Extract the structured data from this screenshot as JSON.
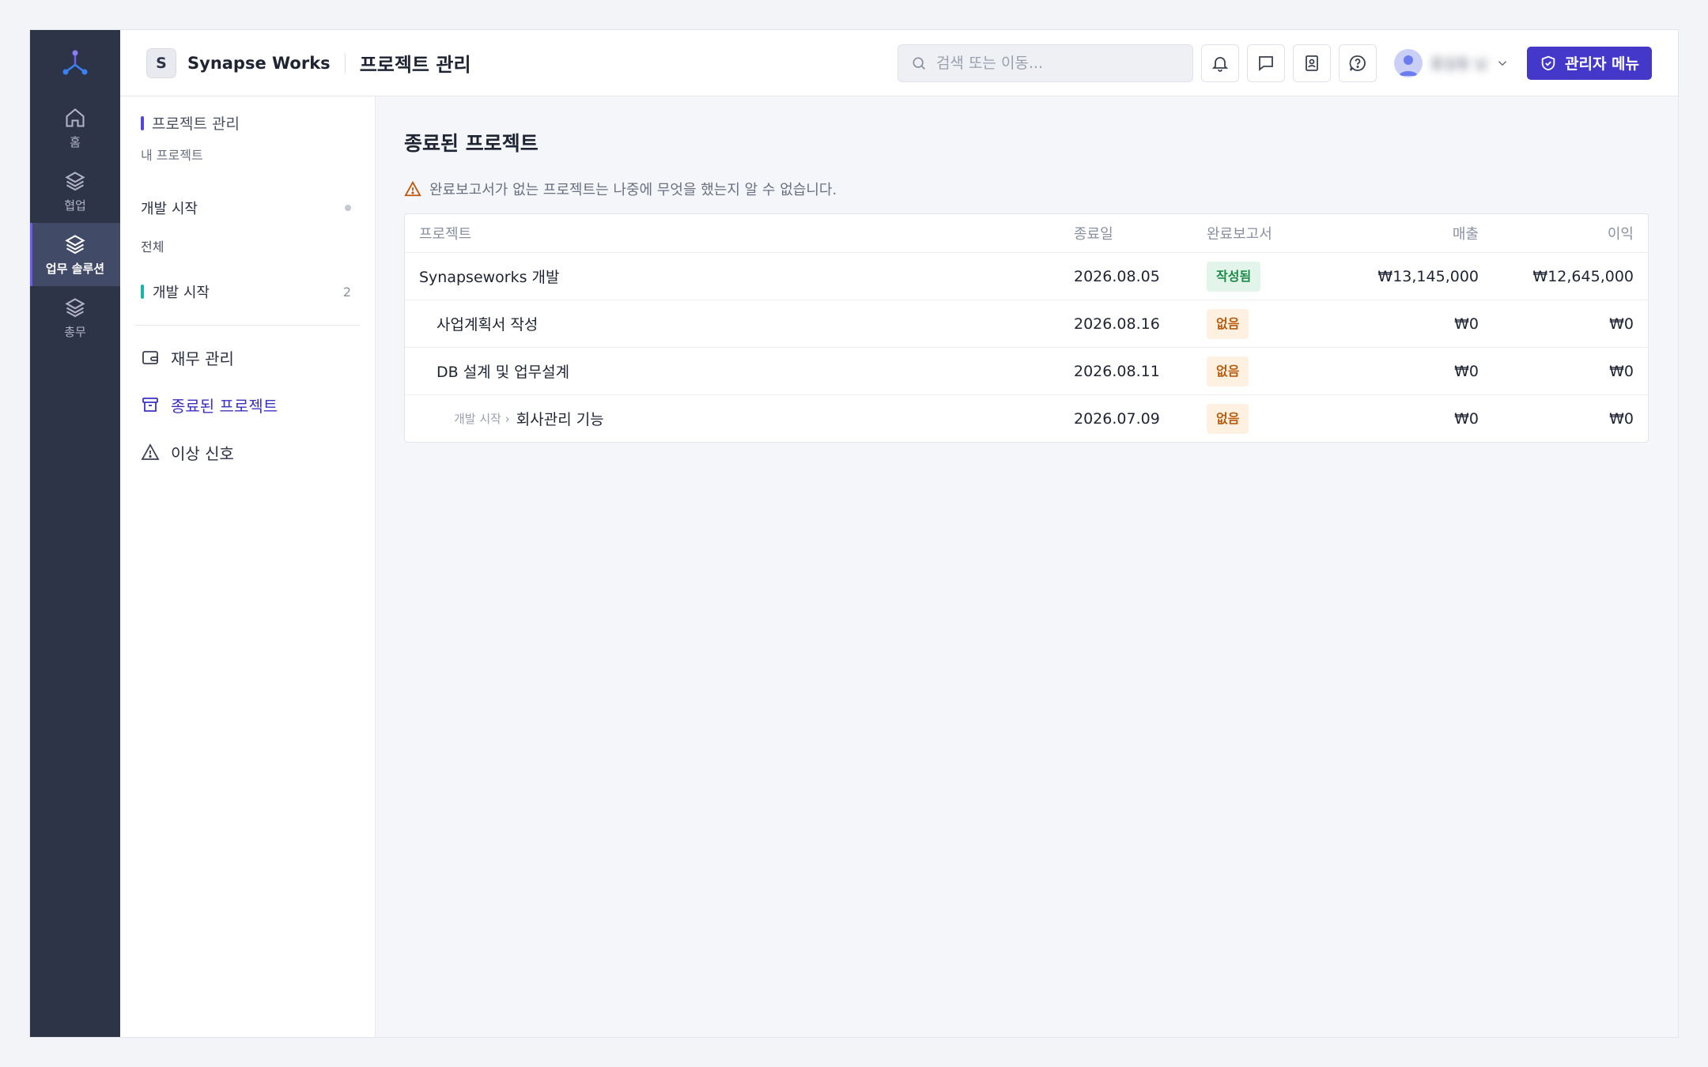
{
  "rail": {
    "items": [
      {
        "label": "홈",
        "icon": "home-icon"
      },
      {
        "label": "협업",
        "icon": "layers-icon"
      },
      {
        "label": "업무 솔루션",
        "icon": "layers-icon"
      },
      {
        "label": "총무",
        "icon": "layers-icon"
      }
    ],
    "active_index": 2
  },
  "header": {
    "workspace_initial": "S",
    "workspace_name": "Synapse Works",
    "page_title": "프로젝트 관리",
    "search_placeholder": "검색 또는 이동...",
    "admin_label": "관리자 메뉴",
    "user_name": "홍길동 님"
  },
  "subnav": {
    "title": "프로젝트 관리",
    "caption": "내 프로젝트",
    "group_label": "개발 시작",
    "all_label": "전체",
    "stage_label": "개발 시작",
    "stage_count": "2",
    "menu": [
      {
        "label": "재무 관리",
        "icon": "wallet-icon"
      },
      {
        "label": "종료된 프로젝트",
        "icon": "archive-icon"
      },
      {
        "label": "이상 신호",
        "icon": "alert-triangle-icon"
      }
    ],
    "active_menu_index": 1
  },
  "content": {
    "heading": "종료된 프로젝트",
    "warning": "완료보고서가 없는 프로젝트는 나중에 무엇을 했는지 알 수 없습니다.",
    "columns": {
      "project": "프로젝트",
      "end_date": "종료일",
      "report": "완료보고서",
      "sales": "매출",
      "profit": "이익"
    },
    "rows": [
      {
        "name": "Synapseworks 개발",
        "prefix": "",
        "date": "2026.08.05",
        "report": "작성됨",
        "status": "done",
        "sales": "₩13,145,000",
        "profit": "₩12,645,000"
      },
      {
        "name": "사업계획서 작성",
        "prefix": "",
        "date": "2026.08.16",
        "report": "없음",
        "status": "none",
        "sales": "₩0",
        "profit": "₩0"
      },
      {
        "name": "DB 설계 및 업무설계",
        "prefix": "",
        "date": "2026.08.11",
        "report": "없음",
        "status": "none",
        "sales": "₩0",
        "profit": "₩0"
      },
      {
        "name": "회사관리 기능",
        "prefix": "개발 시작 ›",
        "date": "2026.07.09",
        "report": "없음",
        "status": "none",
        "sales": "₩0",
        "profit": "₩0"
      }
    ]
  },
  "colors": {
    "rail_bg": "#2e3448",
    "accent": "#4338ca",
    "done": "#1d8a47",
    "none": "#b85c0e"
  }
}
